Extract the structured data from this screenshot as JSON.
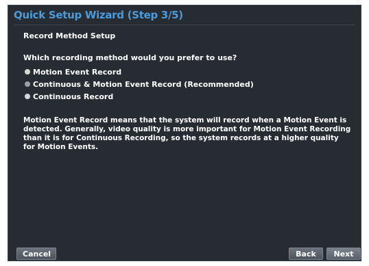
{
  "window": {
    "title": "Quick Setup Wizard (Step 3/5)"
  },
  "section": {
    "title": "Record Method Setup",
    "question": "Which recording method would you prefer to use?"
  },
  "options": [
    {
      "label": "Motion Event Record",
      "selected": false
    },
    {
      "label": "Continuous & Motion Event Record (Recommended)",
      "selected": true
    },
    {
      "label": "Continuous Record",
      "selected": false
    }
  ],
  "description": "Motion Event Record means that the system will record when a Motion Event is detected. Generally, video quality is more important for Motion Event Recording than it is for Continuous Recording, so the system records at a higher quality for Motion Events.",
  "buttons": {
    "cancel": "Cancel",
    "back": "Back",
    "next": "Next"
  },
  "colors": {
    "background": "#272c33",
    "title": "#4a9bdc",
    "text": "#ffffff",
    "radio": "#d8d8d8",
    "radio_selected": "#9aa0a6"
  }
}
